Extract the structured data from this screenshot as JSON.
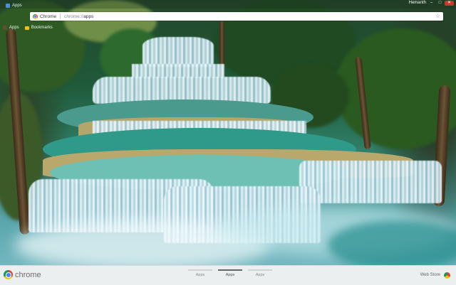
{
  "window": {
    "tab_label": "Apps",
    "user_name": "Hemanth",
    "controls": {
      "minimize": "–",
      "maximize": "□",
      "close": "✕"
    }
  },
  "omnibox": {
    "chip_label": "Chrome",
    "url_host": "chrome://",
    "url_path": "apps",
    "star_icon": "star-icon"
  },
  "bookmarks": {
    "items": [
      {
        "label": "Apps",
        "icon": "apps-grid-icon"
      },
      {
        "label": "Bookmarks",
        "icon": "folder-icon"
      }
    ]
  },
  "bottom_bar": {
    "brand_text": "chrome",
    "pages": [
      {
        "label": "Apps",
        "active": false
      },
      {
        "label": "Apps",
        "active": true
      },
      {
        "label": "Apps",
        "active": false
      }
    ],
    "webstore_label": "Web Store"
  },
  "colors": {
    "close_button": "#c43b2c",
    "bottom_bar_bg": "#eceff0",
    "active_page_indicator": "#666666"
  }
}
